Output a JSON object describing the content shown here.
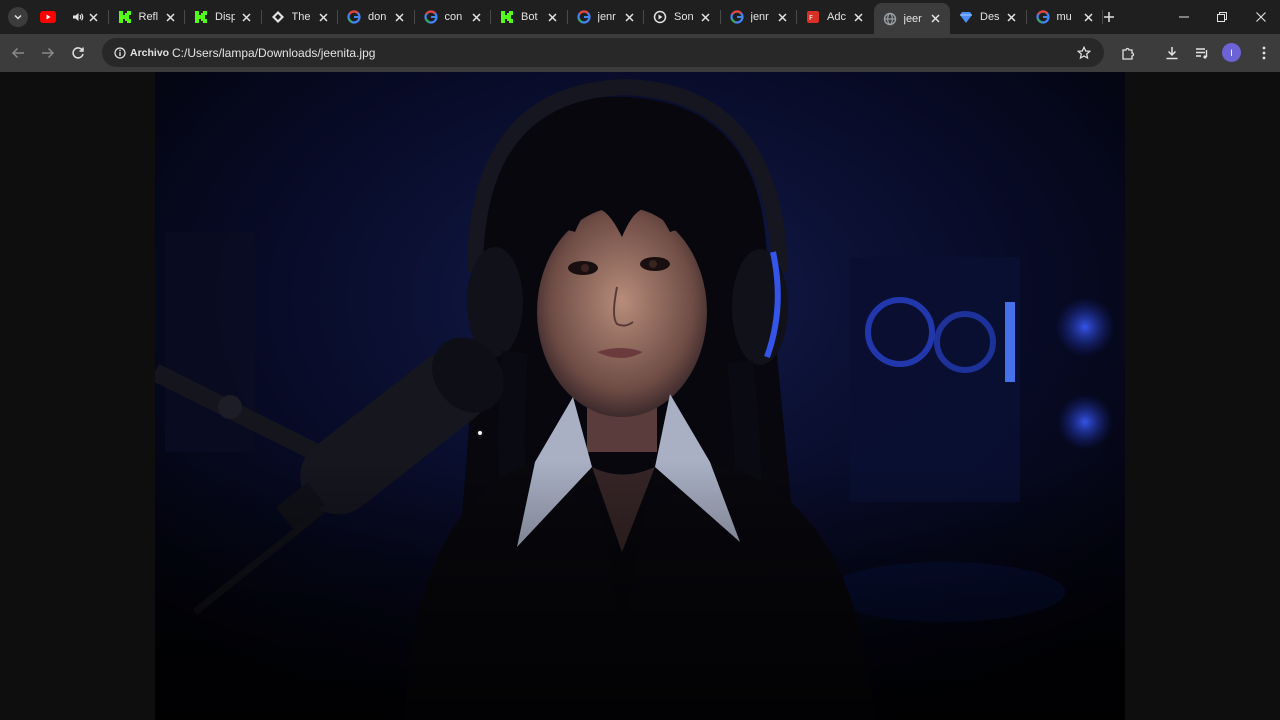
{
  "browser": {
    "tabs": [
      {
        "title": "",
        "favicon": "youtube-icon",
        "color": "#ff0000"
      },
      {
        "title": "Refl",
        "favicon": "kick-icon",
        "color": "#53fc18"
      },
      {
        "title": "Disp",
        "favicon": "kick-icon",
        "color": "#53fc18"
      },
      {
        "title": "The",
        "favicon": "diamond-icon",
        "color": "#e3e3e3"
      },
      {
        "title": "don",
        "favicon": "google-icon",
        "color": "#4285f4"
      },
      {
        "title": "con",
        "favicon": "google-icon",
        "color": "#4285f4"
      },
      {
        "title": "Bot",
        "favicon": "kick-icon",
        "color": "#53fc18"
      },
      {
        "title": "jenr",
        "favicon": "google-icon",
        "color": "#4285f4"
      },
      {
        "title": "Son",
        "favicon": "record-icon",
        "color": "#e3e3e3"
      },
      {
        "title": "jenr",
        "favicon": "google-icon",
        "color": "#4285f4"
      },
      {
        "title": "Adc",
        "favicon": "pdf-icon",
        "color": "#d93025"
      },
      {
        "title": "jeer",
        "favicon": "globe-icon",
        "color": "#9aa0a6",
        "active": true
      },
      {
        "title": "Des",
        "favicon": "gem-icon",
        "color": "#4c8df6"
      },
      {
        "title": "mu",
        "favicon": "google-icon",
        "color": "#4285f4"
      }
    ],
    "address": {
      "chip_label": "Archivo",
      "url": "C:/Users/lampa/Downloads/jeenita.jpg"
    },
    "profile_initial": "I"
  },
  "colors": {
    "tabstrip": "#1f1f1f",
    "toolbar": "#3c3c3c",
    "omnibox": "#282828",
    "viewer_bg": "#0e0e0e",
    "photo_accent": "#2b3bd6"
  }
}
